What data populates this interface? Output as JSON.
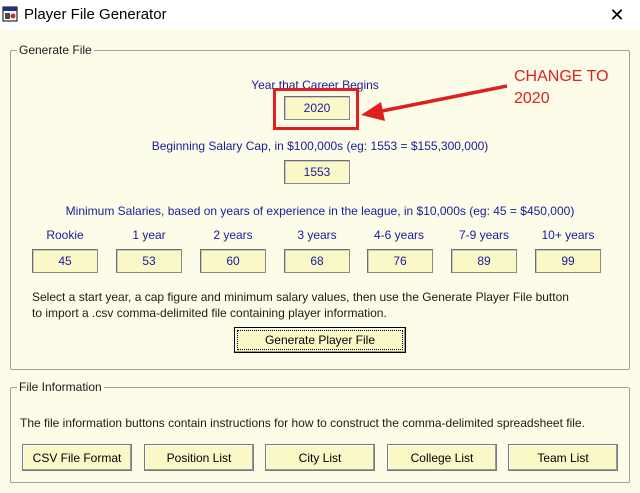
{
  "window": {
    "title": "Player File Generator",
    "close_glyph": "✕",
    "app_icon": "app-icon"
  },
  "generate": {
    "legend": "Generate File",
    "career_label": "Year that Career Begins",
    "career_value": "2020",
    "cap_label": "Beginning Salary Cap, in $100,000s  (eg: 1553 = $155,300,000)",
    "cap_value": "1553",
    "min_label": "Minimum Salaries, based on years of experience in the league, in $10,000s (eg: 45 = $450,000)",
    "columns": [
      {
        "label": "Rookie",
        "value": "45"
      },
      {
        "label": "1 year",
        "value": "53"
      },
      {
        "label": "2 years",
        "value": "60"
      },
      {
        "label": "3 years",
        "value": "68"
      },
      {
        "label": "4-6 years",
        "value": "76"
      },
      {
        "label": "7-9 years",
        "value": "89"
      },
      {
        "label": "10+ years",
        "value": "99"
      }
    ],
    "instructions_line1": "Select a start year, a cap figure and minimum salary values, then use the Generate Player File button",
    "instructions_line2": "to import a .csv comma-delimited file containing player information.",
    "generate_button": "Generate Player File"
  },
  "info": {
    "legend": "File Information",
    "description": "The file information buttons contain instructions for how to construct the comma-delimited spreadsheet file.",
    "buttons": [
      "CSV File Format",
      "Position List",
      "City List",
      "College List",
      "Team List"
    ]
  },
  "annotation": {
    "line1": "CHANGE TO",
    "line2": "2020",
    "color": "#e02020"
  }
}
